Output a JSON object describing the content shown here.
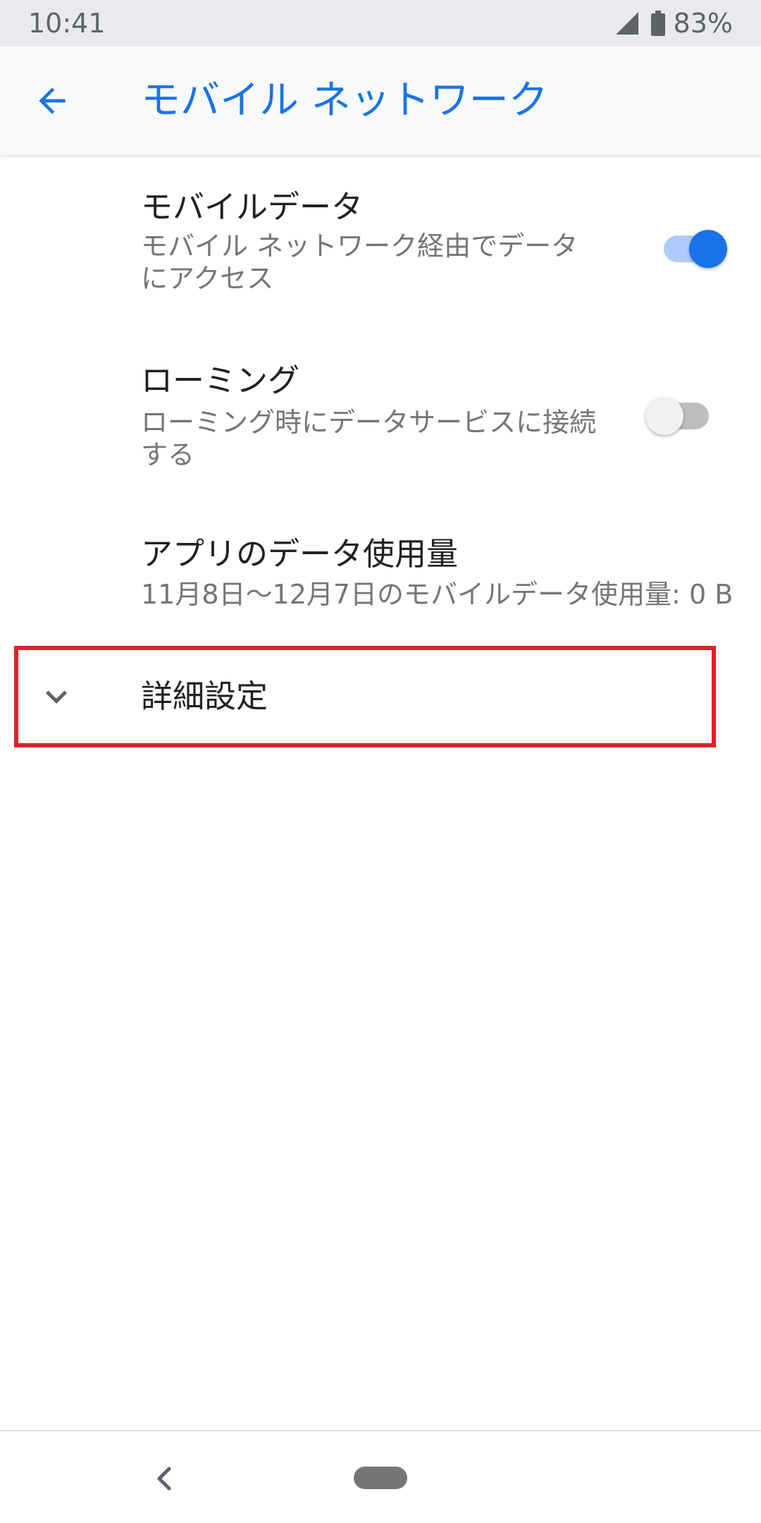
{
  "status_bar": {
    "time": "10:41",
    "battery": "83%",
    "icons": [
      "signal-icon",
      "battery-icon"
    ]
  },
  "app_bar": {
    "back_icon": "arrow-back-icon",
    "title": "モバイル ネットワーク"
  },
  "preferences": {
    "mobile_data": {
      "title": "モバイルデータ",
      "summary_line1": "モバイル ネットワーク経由でデータ",
      "summary_line2": "にアクセス",
      "enabled": true
    },
    "roaming": {
      "title": "ローミング",
      "summary_line1": "ローミング時にデータサービスに接続",
      "summary_line2": "する",
      "enabled": false
    },
    "app_data_usage": {
      "title": "アプリのデータ使用量",
      "summary": "11月8日～12月7日のモバイルデータ使用量: 0 B"
    },
    "advanced": {
      "icon": "chevron-down-icon",
      "label": "詳細設定"
    }
  },
  "nav_bar": {
    "back_icon": "nav-back-icon",
    "home_icon": "home-pill-icon"
  },
  "colors": {
    "accent": "#1a73e8",
    "highlight_box": "#e0202a",
    "status_bar_bg": "#e8eaed",
    "app_bar_bg": "#f8f9fa"
  }
}
